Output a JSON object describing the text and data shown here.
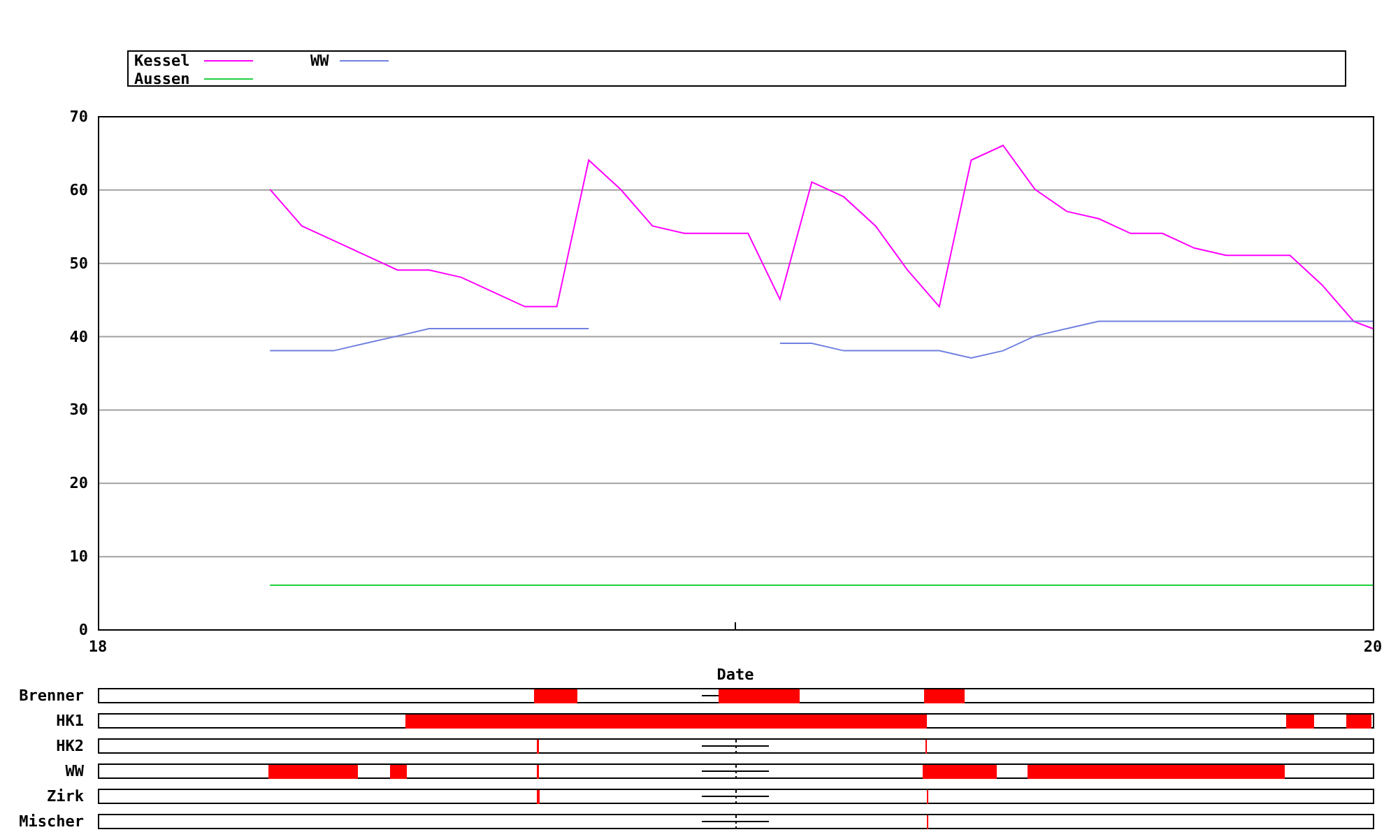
{
  "chart": {
    "chart_data": {
      "type": "line",
      "grid": true,
      "xlabel": "Date",
      "xlim": [
        18,
        20
      ],
      "ylim": [
        0,
        70
      ],
      "xticks": [
        18,
        20
      ],
      "yticks": [
        0,
        10,
        20,
        30,
        40,
        50,
        60,
        70
      ],
      "x": [
        18.27,
        18.32,
        18.37,
        18.42,
        18.47,
        18.52,
        18.57,
        18.62,
        18.67,
        18.72,
        18.77,
        18.82,
        18.87,
        18.92,
        18.97,
        19.02,
        19.07,
        19.12,
        19.17,
        19.22,
        19.27,
        19.32,
        19.37,
        19.42,
        19.47,
        19.52,
        19.57,
        19.62,
        19.67,
        19.72,
        19.77,
        19.82,
        19.87,
        19.92,
        19.97,
        20.0
      ],
      "series": [
        {
          "name": "Kessel",
          "color": "#ff00ff",
          "values": [
            60,
            55,
            53,
            51,
            49,
            49,
            48,
            46,
            44,
            44,
            64,
            60,
            55,
            54,
            54,
            54,
            45,
            61,
            59,
            55,
            49,
            44,
            64,
            66,
            60,
            57,
            56,
            54,
            54,
            52,
            51,
            51,
            51,
            47,
            42,
            41
          ]
        },
        {
          "name": "Aussen",
          "color": "#20d040",
          "values": [
            6,
            6,
            6,
            6,
            6,
            6,
            6,
            6,
            6,
            6,
            6,
            6,
            6,
            6,
            6,
            6,
            6,
            6,
            6,
            6,
            6,
            6,
            6,
            6,
            6,
            6,
            6,
            6,
            6,
            6,
            6,
            6,
            6,
            6,
            6,
            6
          ]
        },
        {
          "name": "WW",
          "color": "#7080e0",
          "values": [
            38,
            38,
            38,
            39,
            40,
            41,
            41,
            41,
            41,
            41,
            41,
            null,
            null,
            null,
            null,
            null,
            39,
            39,
            38,
            38,
            38,
            38,
            37,
            38,
            40,
            41,
            42,
            42,
            42,
            42,
            42,
            42,
            42,
            42,
            42,
            42
          ]
        }
      ]
    }
  },
  "status_rows": [
    {
      "label": "Brenner"
    },
    {
      "label": "HK1"
    },
    {
      "label": "HK2"
    },
    {
      "label": "WW"
    },
    {
      "label": "Zirk"
    },
    {
      "label": "Mischer"
    }
  ]
}
